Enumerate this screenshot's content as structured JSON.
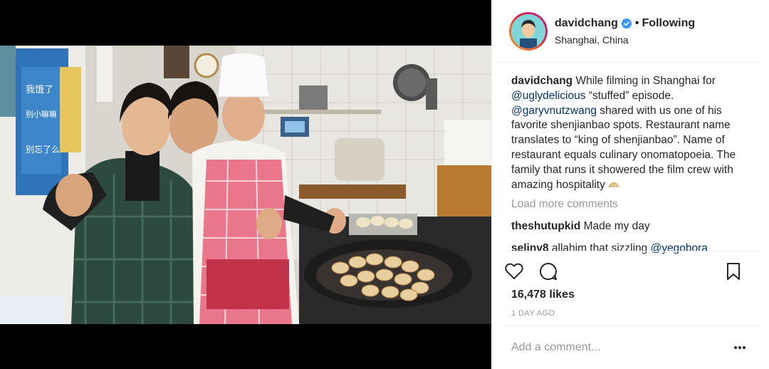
{
  "post": {
    "author": {
      "username": "davidchang",
      "verified": true,
      "follow_status": "Following",
      "separator": "•",
      "location": "Shanghai, China"
    },
    "photo": {
      "signs": [
        "我饿了",
        "别小嘛嘛",
        "别忘了么"
      ]
    },
    "caption": {
      "username": "davidchang",
      "segments": [
        {
          "text": "While filming in Shanghai for ",
          "type": "text"
        },
        {
          "text": "@uglydelicious",
          "type": "mention"
        },
        {
          "text": " “stuffed” episode. ",
          "type": "text"
        },
        {
          "text": "@garyvnutzwang",
          "type": "mention"
        },
        {
          "text": " shared with us one of his favorite shenjianbao spots. Restaurant name translates to “king of shenjianbao”. Name of restaurant equals culinary onomatopoeia. The family that runs it showered the film crew with amazing hospitality ",
          "type": "text"
        }
      ],
      "emoji": "dumpling-emoji"
    },
    "load_more_label": "Load more comments",
    "comments": [
      {
        "username": "theshutupkid",
        "text": "Made my day",
        "mention": ""
      },
      {
        "username": "selinv8",
        "text": "allahim that sizzling ",
        "mention": "@yegobora"
      }
    ],
    "likes": "16,478 likes",
    "timestamp": "1 DAY AGO",
    "add_comment_placeholder": "Add a comment...",
    "icons": {
      "like": "heart-icon",
      "comment": "comment-bubble-icon",
      "save": "bookmark-icon",
      "more": "more-options-icon",
      "verified": "verified-badge-icon"
    },
    "colors": {
      "mention": "#003569",
      "muted": "#999999",
      "verified": "#3897f0",
      "text": "#262626"
    }
  }
}
